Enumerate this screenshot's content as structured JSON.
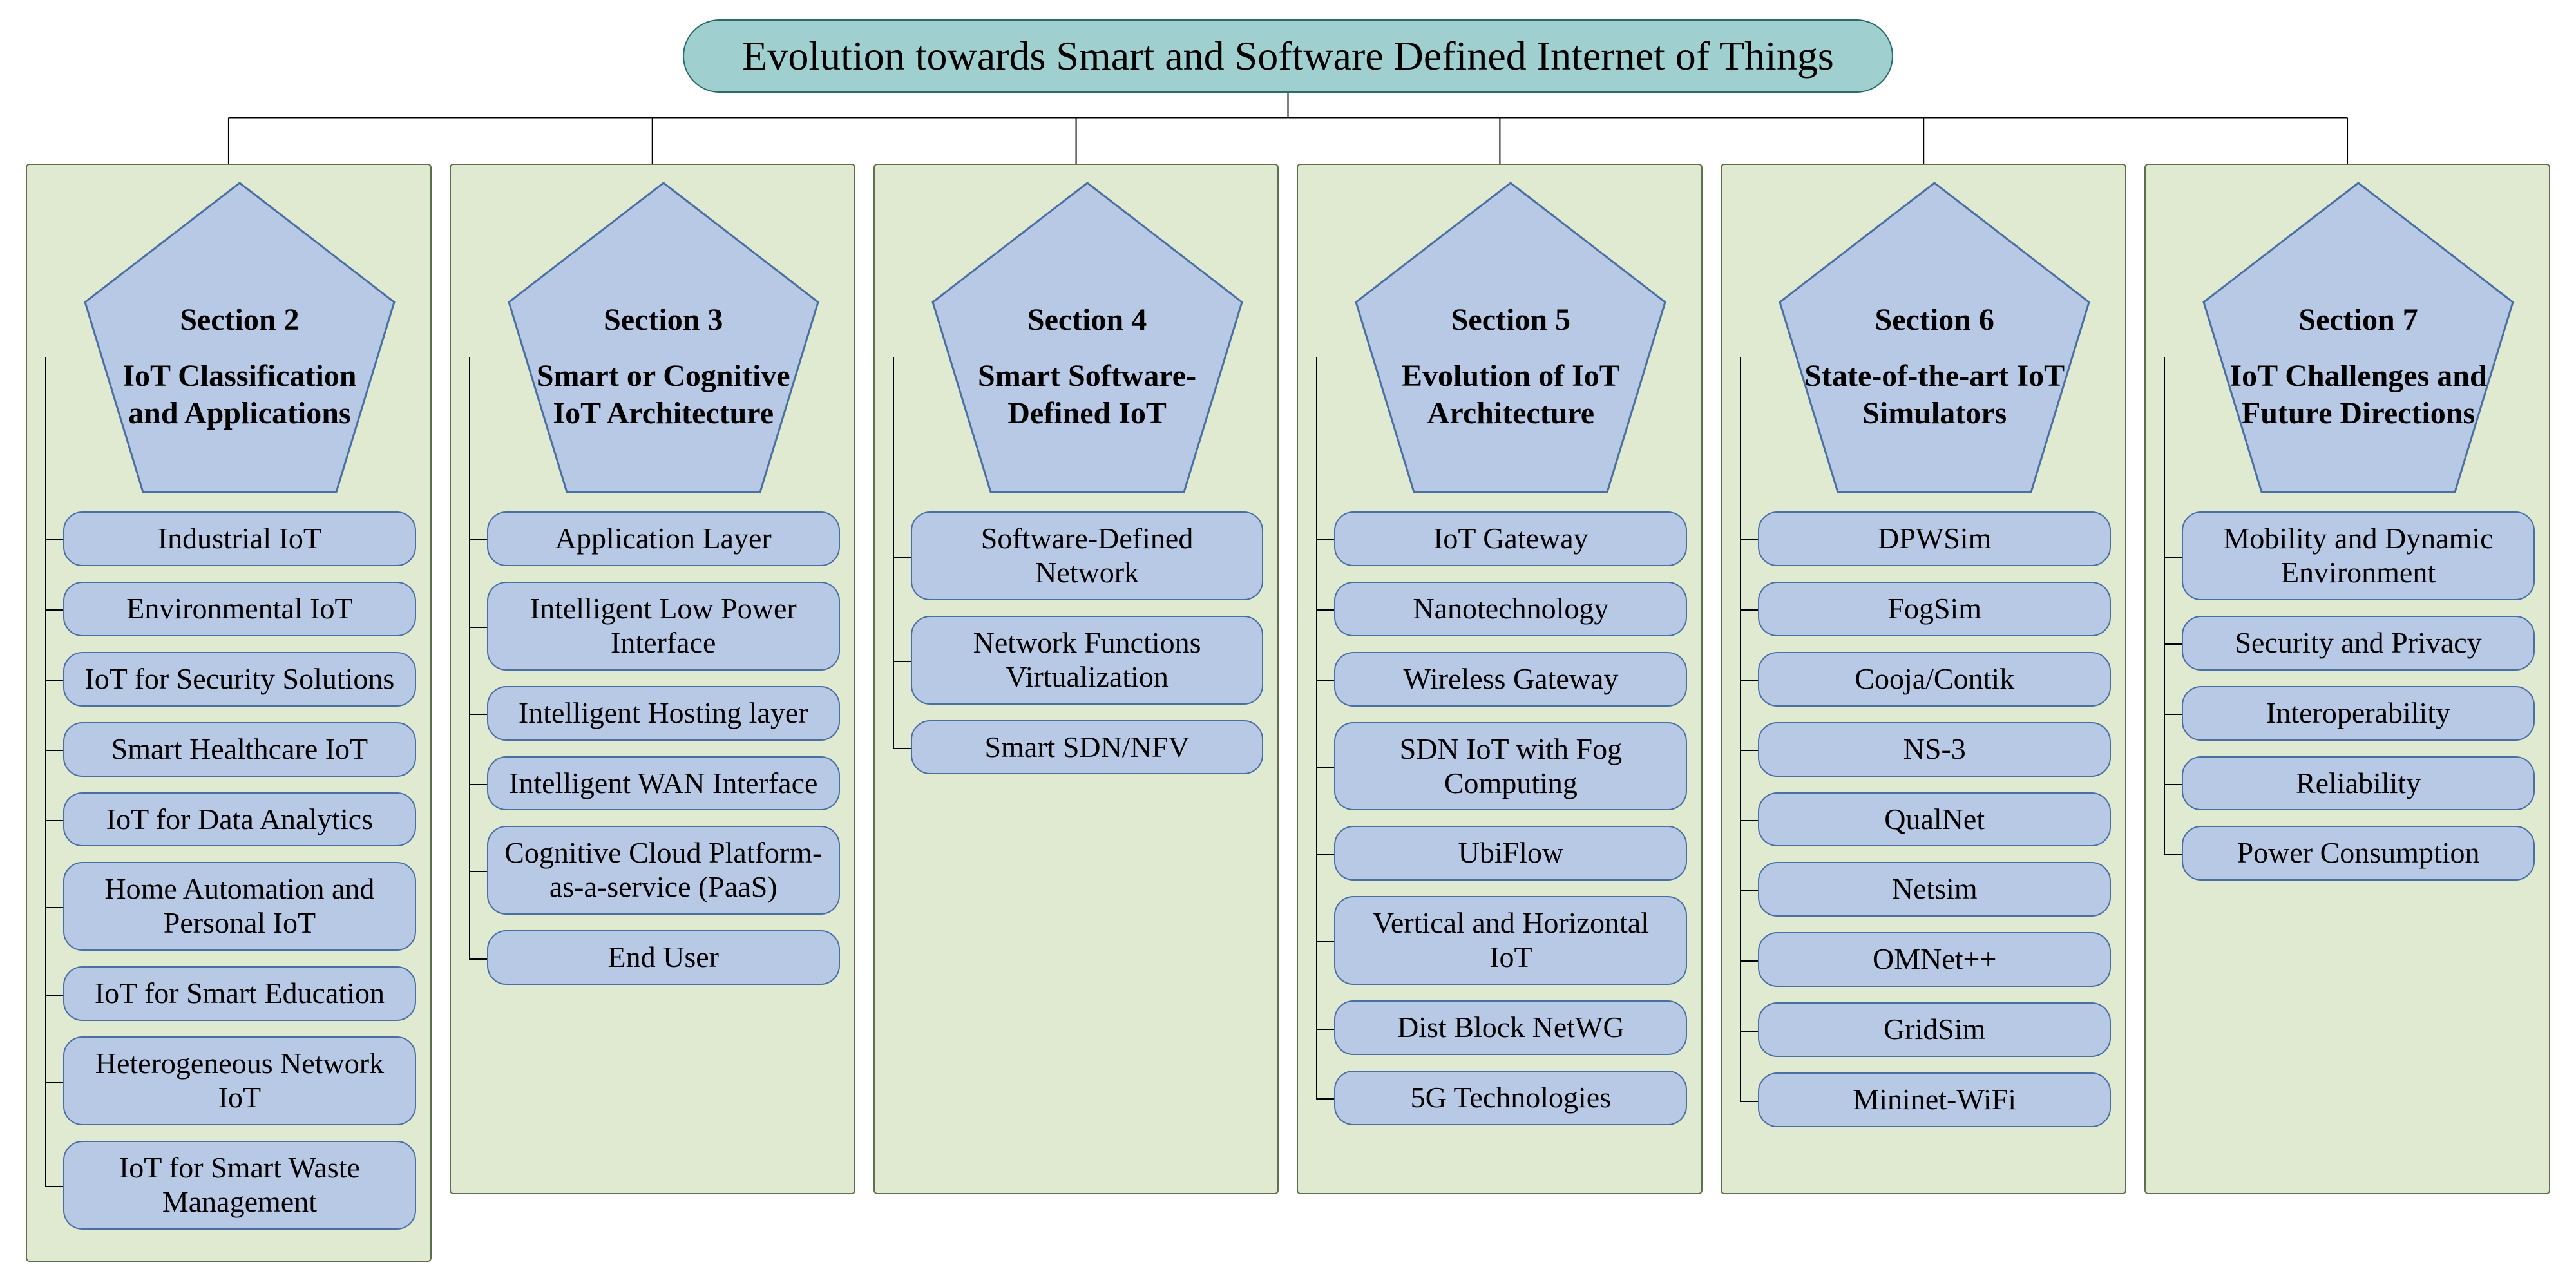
{
  "title": "Evolution towards Smart and Software Defined Internet of Things",
  "sections": [
    {
      "label": "Section 2",
      "heading": "IoT Classification and Applications",
      "items": [
        "Industrial IoT",
        "Environmental IoT",
        "IoT for Security Solutions",
        "Smart Healthcare IoT",
        "IoT for Data Analytics",
        "Home Automation and Personal IoT",
        "IoT for Smart Education",
        "Heterogeneous Network IoT",
        "IoT for Smart Waste Management"
      ]
    },
    {
      "label": "Section 3",
      "heading": "Smart or Cognitive IoT Architecture",
      "items": [
        "Application Layer",
        "Intelligent Low Power Interface",
        "Intelligent Hosting layer",
        "Intelligent WAN Interface",
        "Cognitive Cloud Platform-as-a-service (PaaS)",
        "End User"
      ]
    },
    {
      "label": "Section 4",
      "heading": "Smart Software-Defined IoT",
      "items": [
        "Software-Defined Network",
        "Network Functions Virtualization",
        "Smart SDN/NFV"
      ]
    },
    {
      "label": "Section 5",
      "heading": "Evolution of IoT Architecture",
      "items": [
        "IoT Gateway",
        "Nanotechnology",
        "Wireless Gateway",
        "SDN IoT with Fog Computing",
        "UbiFlow",
        "Vertical and Horizontal IoT",
        "Dist Block NetWG",
        "5G Technologies"
      ]
    },
    {
      "label": "Section 6",
      "heading": "State-of-the-art IoT Simulators",
      "items": [
        "DPWSim",
        "FogSim",
        "Cooja/Contik",
        "NS-3",
        "QualNet",
        "Netsim",
        "OMNet++",
        "GridSim",
        "Mininet-WiFi"
      ]
    },
    {
      "label": "Section 7",
      "heading": "IoT Challenges and Future Directions",
      "items": [
        "Mobility and Dynamic Environment",
        "Security and Privacy",
        "Interoperability",
        "Reliability",
        "Power Consumption"
      ]
    }
  ]
}
